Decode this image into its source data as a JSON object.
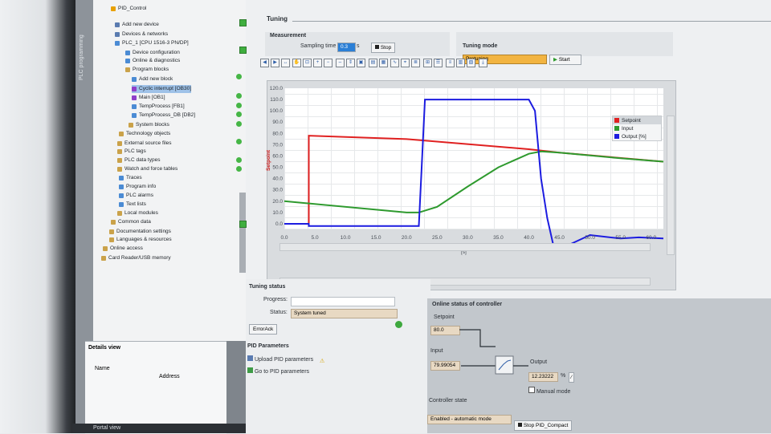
{
  "portal": {
    "sidebar_label": "PLC programming",
    "bottom_label": "Portal view"
  },
  "tree": {
    "items": [
      {
        "label": "PID_Control"
      },
      {
        "label": "Add new device"
      },
      {
        "label": "Devices & networks"
      },
      {
        "label": "PLC_1 [CPU 1516-3 PN/DP]"
      },
      {
        "label": "Device configuration"
      },
      {
        "label": "Online & diagnostics"
      },
      {
        "label": "Program blocks"
      },
      {
        "label": "Add new block"
      },
      {
        "label": "Cyclic interrupt [OB30]"
      },
      {
        "label": "Main [OB1]"
      },
      {
        "label": "TempProcess [FB1]"
      },
      {
        "label": "TempProcess_DB [DB2]"
      },
      {
        "label": "System blocks"
      },
      {
        "label": "Technology objects"
      },
      {
        "label": "External source files"
      },
      {
        "label": "PLC tags"
      },
      {
        "label": "PLC data types"
      },
      {
        "label": "Watch and force tables"
      },
      {
        "label": "Traces"
      },
      {
        "label": "Program info"
      },
      {
        "label": "PLC alarms"
      },
      {
        "label": "Text lists"
      },
      {
        "label": "Local modules"
      },
      {
        "label": "Common data"
      },
      {
        "label": "Documentation settings"
      },
      {
        "label": "Languages & resources"
      },
      {
        "label": "Online access"
      },
      {
        "label": "Card Reader/USB memory"
      }
    ]
  },
  "details": {
    "title": "Details view",
    "col_name": "Name",
    "col_address": "Address"
  },
  "tuning": {
    "title": "Tuning"
  },
  "measurement": {
    "title": "Measurement",
    "sampling_label": "Sampling time",
    "sampling_value": "0.3",
    "sampling_unit": "s",
    "stop_label": "Stop"
  },
  "tuning_mode": {
    "title": "Tuning mode",
    "value": "Pretuning",
    "start_label": "Start"
  },
  "chart_data": {
    "type": "line",
    "ylabel": "Setpoint",
    "xlabel": "[s]",
    "x_ticks": [
      "0.0",
      "5.0",
      "10.0",
      "15.0",
      "20.0",
      "25.0",
      "30.0",
      "35.0",
      "40.0",
      "45.0",
      "50.0",
      "55.0",
      "60.0"
    ],
    "y_ticks": [
      "0.0",
      "10.0",
      "20.0",
      "30.0",
      "40.0",
      "50.0",
      "60.0",
      "70.0",
      "80.0",
      "90.0",
      "100.0",
      "110.0",
      "120.0"
    ],
    "xlim": [
      0,
      62
    ],
    "ylim": [
      -5,
      120
    ],
    "series": [
      {
        "name": "Setpoint",
        "color": "#e02020",
        "points": [
          [
            0,
            0
          ],
          [
            4,
            0
          ],
          [
            4,
            78
          ],
          [
            20,
            75
          ],
          [
            40,
            66
          ],
          [
            45,
            63
          ],
          [
            62,
            55
          ]
        ]
      },
      {
        "name": "Input",
        "color": "#2e9a2e",
        "points": [
          [
            0,
            20
          ],
          [
            20,
            10
          ],
          [
            22,
            10
          ],
          [
            25,
            15
          ],
          [
            30,
            33
          ],
          [
            35,
            50
          ],
          [
            40,
            62
          ],
          [
            42,
            64
          ],
          [
            45,
            63
          ],
          [
            55,
            58
          ],
          [
            62,
            55
          ]
        ]
      },
      {
        "name": "Output [%]",
        "color": "#1c1ce0",
        "points": [
          [
            0,
            0
          ],
          [
            4,
            0
          ],
          [
            4,
            -2
          ],
          [
            22,
            -2
          ],
          [
            23,
            110
          ],
          [
            40,
            110
          ],
          [
            41,
            100
          ],
          [
            42,
            40
          ],
          [
            43,
            5
          ],
          [
            44,
            -19
          ],
          [
            46,
            -20
          ],
          [
            50,
            -10
          ],
          [
            55,
            -13
          ],
          [
            58,
            -12
          ],
          [
            62,
            -13
          ]
        ]
      }
    ],
    "legend": "top-right",
    "grid": true
  },
  "tuning_status": {
    "title": "Tuning status",
    "progress_label": "Progress:",
    "progress_value": 0,
    "status_label": "Status:",
    "status_value": "System tuned",
    "errack_label": "ErrorAck"
  },
  "pid_params": {
    "title": "PID Parameters",
    "upload_label": "Upload PID parameters",
    "goto_label": "Go to PID parameters"
  },
  "online": {
    "title": "Online status of controller",
    "setpoint_label": "Setpoint",
    "setpoint_value": "80.0",
    "input_label": "Input",
    "input_value": "79.99054",
    "output_label": "Output",
    "output_value": "12.23222",
    "output_unit": "%",
    "manual_label": "Manual mode",
    "state_label": "Controller state",
    "state_value": "Enabled - automatic mode",
    "stop_label": "Stop PID_Compact"
  }
}
